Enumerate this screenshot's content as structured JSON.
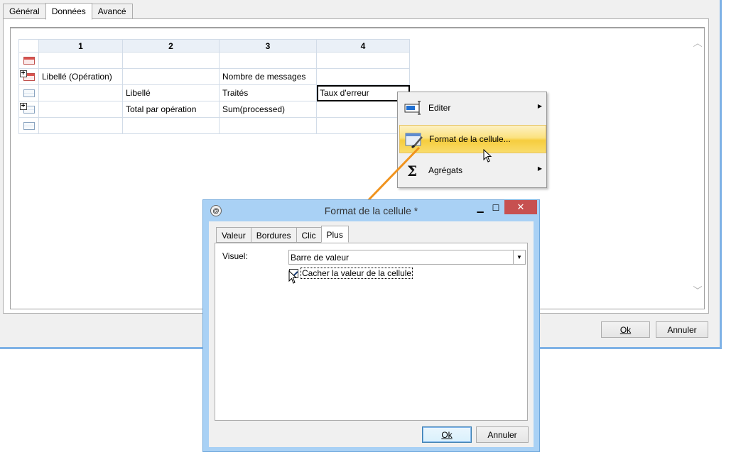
{
  "main_window": {
    "tabs": [
      {
        "label": "Général",
        "active": false
      },
      {
        "label": "Données",
        "active": true
      },
      {
        "label": "Avancé",
        "active": false
      }
    ],
    "grid": {
      "columns": [
        "1",
        "2",
        "3",
        "4"
      ],
      "rows": [
        {
          "icon": "header-row-icon",
          "cells": [
            "",
            "",
            "",
            ""
          ]
        },
        {
          "icon": "expand-row-icon",
          "cells": [
            "Libellé (Opération)",
            "",
            "Nombre de messages",
            ""
          ]
        },
        {
          "icon": "data-row-icon",
          "cells": [
            "",
            "Libellé",
            "Traités",
            "Taux d'erreur"
          ]
        },
        {
          "icon": "total-row-icon",
          "cells": [
            "",
            "Total par opération",
            "Sum(processed)",
            ""
          ]
        },
        {
          "icon": "footer-row-icon",
          "cells": [
            "",
            "",
            "",
            ""
          ]
        }
      ],
      "selected_cell": "Taux d'erreur"
    },
    "ok_label": "Ok",
    "cancel_label": "Annuler"
  },
  "context_menu": {
    "items": [
      {
        "label": "Editer",
        "icon": "edit-cell-icon",
        "has_submenu": true
      },
      {
        "label": "Format de la cellule...",
        "icon": "format-cell-icon",
        "has_submenu": false,
        "highlighted": true
      },
      {
        "label": "Agrégats",
        "icon": "sigma-icon",
        "has_submenu": true
      }
    ]
  },
  "dialog": {
    "title": "Format de la cellule *",
    "tabs": [
      {
        "label": "Valeur",
        "active": false
      },
      {
        "label": "Bordures",
        "active": false
      },
      {
        "label": "Clic",
        "active": false
      },
      {
        "label": "Plus",
        "active": true
      }
    ],
    "visuel_label": "Visuel:",
    "visuel_value": "Barre de valeur",
    "hide_value_label": "Cacher la valeur de la cellule",
    "hide_value_checked": true,
    "ok_label": "Ok",
    "cancel_label": "Annuler"
  },
  "colors": {
    "window_border": "#7fb2e6",
    "menu_highlight": "#f6cd3e",
    "dialog_frame": "#a9d1f5",
    "close_button": "#c75050",
    "callout_arrow": "#f0931e"
  }
}
